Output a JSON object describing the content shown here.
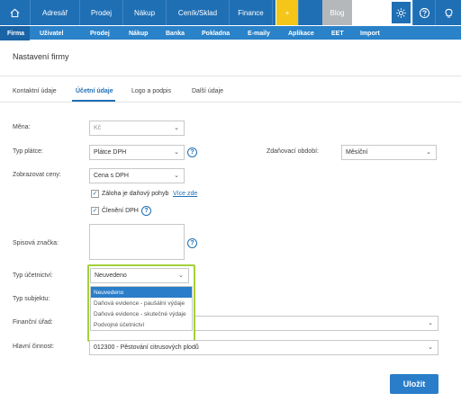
{
  "topnav": {
    "items": [
      "Adresář",
      "Prodej",
      "Nákup",
      "Ceník/Sklad",
      "Finance"
    ],
    "plus_label": "+",
    "blog_label": "Blog"
  },
  "subnav": {
    "items": [
      "Firma",
      "Uživatel",
      "Prodej",
      "Nákup",
      "Banka",
      "Pokladna",
      "E-maily",
      "Aplikace",
      "EET",
      "Import"
    ]
  },
  "page": {
    "title": "Nastavení firmy"
  },
  "tabs": [
    "Kontaktní údaje",
    "Účetní údaje",
    "Logo a podpis",
    "Další údaje"
  ],
  "form": {
    "mena_label": "Měna:",
    "mena_value": "Kč",
    "typ_platce_label": "Typ plátce:",
    "typ_platce_value": "Plátce DPH",
    "zdanovaci_label": "Zdaňovací období:",
    "zdanovaci_value": "Měsíční",
    "zobrazovat_label": "Zobrazovat ceny:",
    "zobrazovat_value": "Cena s DPH",
    "zaloha_label": "Záloha je daňový pohyb",
    "vice_zde": "Více zde",
    "cleneni_label": "Členění DPH",
    "spisova_label": "Spisová značka:",
    "typ_ucetnictvi_label": "Typ účetnictví:",
    "typ_ucetnictvi_value": "Neuvedeno",
    "typ_subjektu_label": "Typ subjektu:",
    "financni_urad_label": "Finanční úřad:",
    "hlavni_cinnost_label": "Hlavní činnost:",
    "hlavni_cinnost_value": "012300 - Pěstování citrusových plodů",
    "dropdown_options": [
      "Neuvedeno",
      "Daňová evidence - paušální výdaje",
      "Daňová evidence - skutečné výdaje",
      "Podvojné účetnictví"
    ],
    "help_glyph": "?",
    "check_glyph": "✓",
    "chevron_glyph": "⌄"
  },
  "save_label": "Uložit",
  "colors": {
    "primary": "#1f6fb5",
    "accent_yellow": "#f5c518",
    "highlight_green": "#a3d13a"
  }
}
